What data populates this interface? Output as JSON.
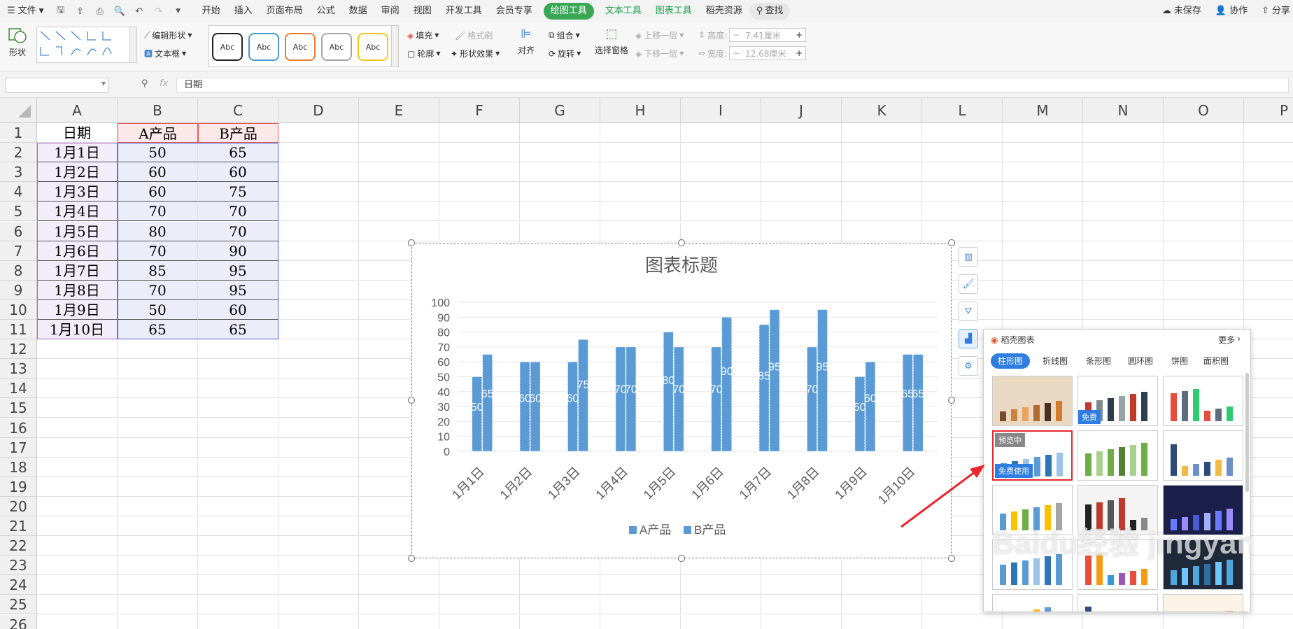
{
  "menubar": {
    "file_label": "文件",
    "tabs": [
      "开始",
      "插入",
      "页面布局",
      "公式",
      "数据",
      "审阅",
      "视图",
      "开发工具",
      "会员专享"
    ],
    "drawing_tools": "绘图工具",
    "text_tools": "文本工具",
    "chart_tools": "图表工具",
    "docer_resources": "稻壳资源",
    "search": "查找",
    "unsaved": "未保存",
    "collaborate": "协作",
    "share": "分享"
  },
  "ribbon": {
    "shape": "形状",
    "edit_shape": "编辑形状",
    "text_box": "文本框",
    "style_sample": "Abc",
    "fill": "填充",
    "format_brush": "格式刷",
    "outline": "轮廓",
    "shape_effects": "形状效果",
    "align": "对齐",
    "group": "组合",
    "rotate": "旋转",
    "selection_pane": "选择窗格",
    "bring_forward": "上移一层",
    "send_backward": "下移一层",
    "height_label": "高度:",
    "height_value": "7.41厘米",
    "width_label": "宽度:",
    "width_value": "12.68厘米",
    "style_colors": [
      "#222222",
      "#4a9ad6",
      "#ec7d31",
      "#a5a5a5",
      "#f5c518"
    ]
  },
  "formula": {
    "value": "日期",
    "fx": "fx"
  },
  "columns": [
    "A",
    "B",
    "C",
    "D",
    "E",
    "F",
    "G",
    "H",
    "I",
    "J",
    "K",
    "L",
    "M",
    "N",
    "O",
    "P"
  ],
  "rows": [
    "1",
    "2",
    "3",
    "4",
    "5",
    "6",
    "7",
    "8",
    "9",
    "10",
    "11",
    "12",
    "13",
    "14",
    "15",
    "16",
    "17",
    "18",
    "19",
    "20",
    "21",
    "22",
    "23",
    "24",
    "25",
    "26"
  ],
  "table": {
    "header": [
      "日期",
      "A产品",
      "B产品"
    ],
    "data": [
      [
        "1月1日",
        "50",
        "65"
      ],
      [
        "1月2日",
        "60",
        "60"
      ],
      [
        "1月3日",
        "60",
        "75"
      ],
      [
        "1月4日",
        "70",
        "70"
      ],
      [
        "1月5日",
        "80",
        "70"
      ],
      [
        "1月6日",
        "70",
        "90"
      ],
      [
        "1月7日",
        "85",
        "95"
      ],
      [
        "1月8日",
        "70",
        "95"
      ],
      [
        "1月9日",
        "50",
        "60"
      ],
      [
        "1月10日",
        "65",
        "65"
      ]
    ]
  },
  "chart_data": {
    "type": "bar",
    "title": "图表标题",
    "categories": [
      "1月1日",
      "1月2日",
      "1月3日",
      "1月4日",
      "1月5日",
      "1月6日",
      "1月7日",
      "1月8日",
      "1月9日",
      "1月10日"
    ],
    "series": [
      {
        "name": "A产品",
        "values": [
          50,
          60,
          60,
          70,
          80,
          70,
          85,
          70,
          50,
          65
        ]
      },
      {
        "name": "B产品",
        "values": [
          65,
          60,
          75,
          70,
          70,
          90,
          95,
          95,
          60,
          65
        ]
      }
    ],
    "yticks": [
      0,
      10,
      20,
      30,
      40,
      50,
      60,
      70,
      80,
      90,
      100
    ],
    "ylim": [
      0,
      100
    ],
    "color": "#5b9bd5",
    "grid": true,
    "legend": "bottom",
    "data_labels": true
  },
  "panel": {
    "title": "稻壳图表",
    "more": "更多",
    "tabs": [
      "柱形图",
      "折线图",
      "条形图",
      "圆环图",
      "饼图",
      "面积图"
    ],
    "badge_free": "免费",
    "badge_preview": "预览中",
    "badge_free_use": "免费使用"
  },
  "watermark": "Baidu经验 jingyan.baidu.com"
}
